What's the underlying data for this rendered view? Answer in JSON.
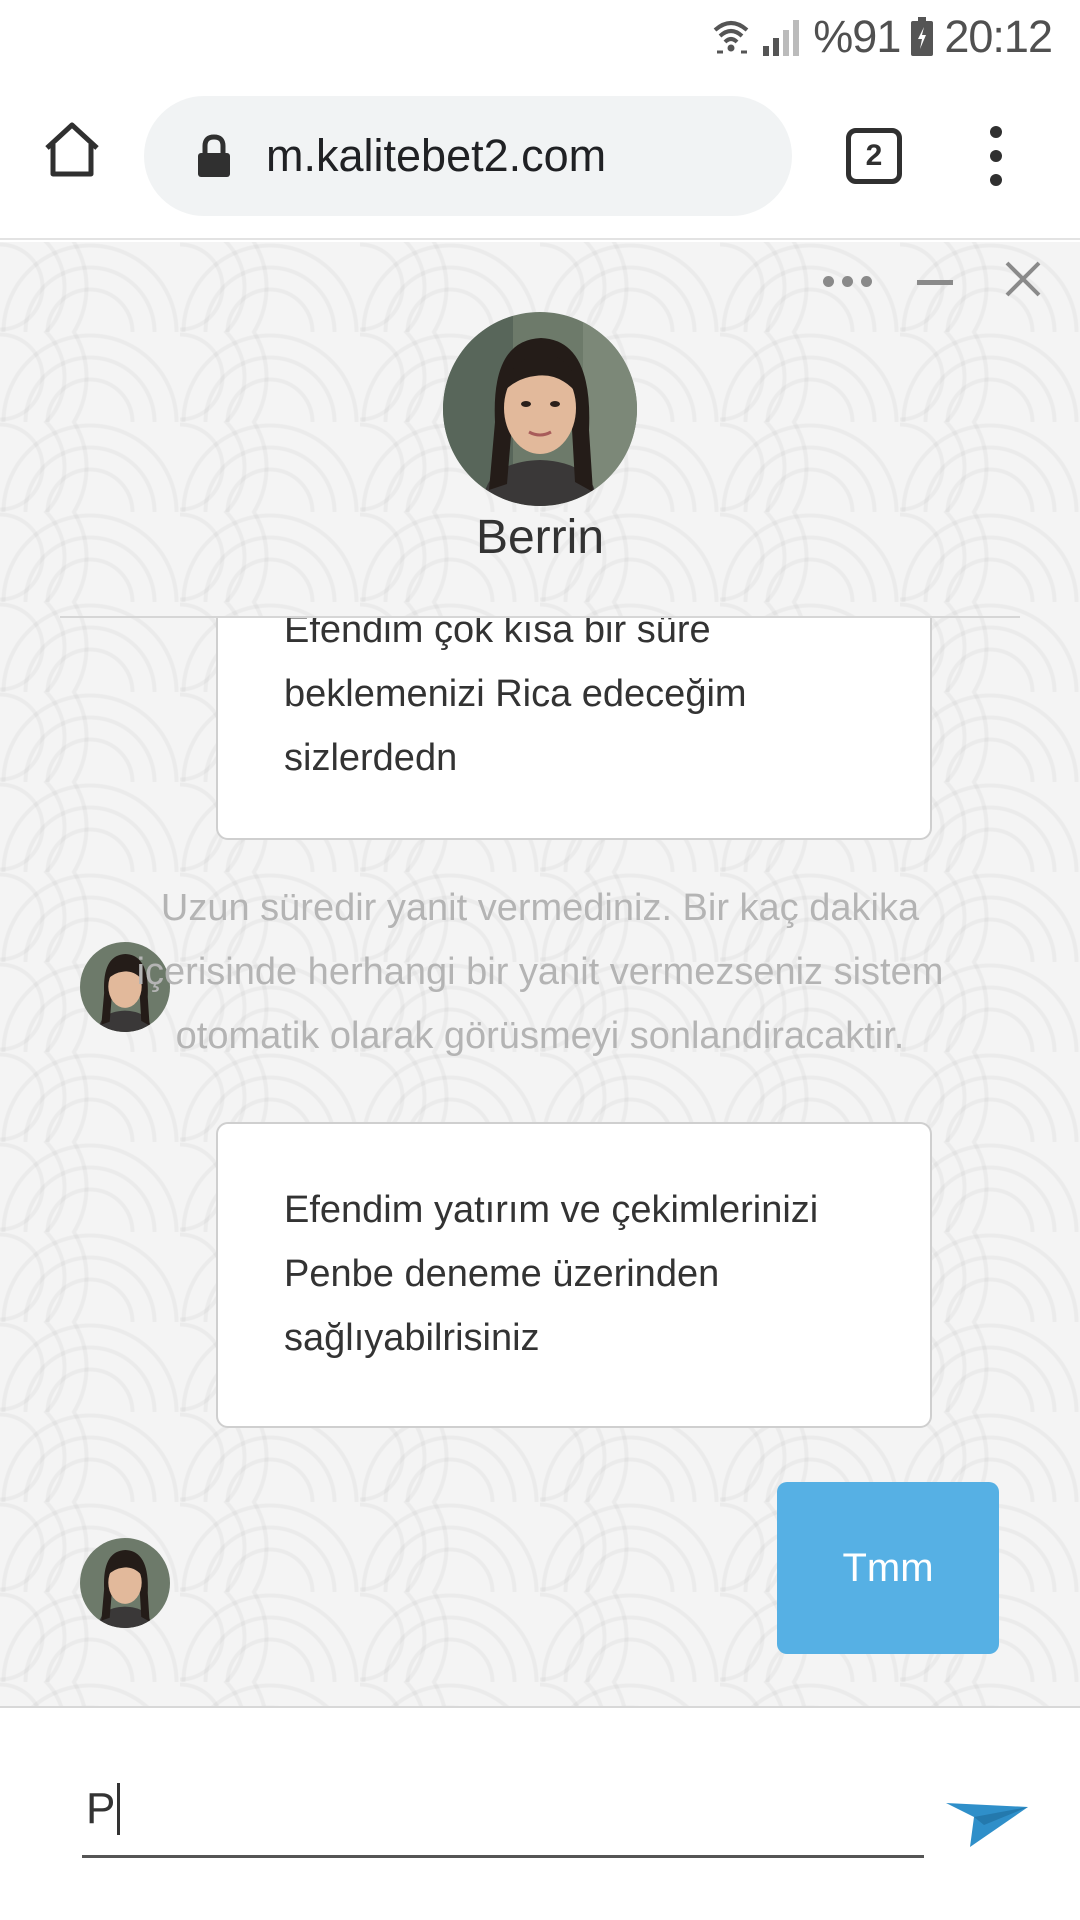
{
  "status_bar": {
    "battery": "%91",
    "time": "20:12",
    "icons": [
      "wifi-icon",
      "signal-icon",
      "battery-icon"
    ]
  },
  "browser": {
    "url": "m.kalitebet2.com",
    "tab_count": "2",
    "icons": [
      "home-icon",
      "lock-icon",
      "tabs-icon",
      "overflow-menu-icon"
    ]
  },
  "chat": {
    "agent_name": "Berrin",
    "controls": [
      "more-icon",
      "minimize-icon",
      "close-icon"
    ],
    "messages": [
      {
        "from": "agent",
        "lines": [
          "Efendim çok kısa bir süre",
          "beklemenizi Rica edeceğim",
          "sizlerdedn"
        ]
      },
      {
        "from": "system",
        "lines": [
          "Uzun süredir yanit vermediniz. Bir kaç dakika",
          "içerisinde herhangi bir yanit vermezseniz sistem",
          "otomatik olarak görüsmeyi sonlandiracaktir."
        ]
      },
      {
        "from": "agent",
        "lines": [
          "Efendim yatırım ve çekimlerinizi",
          "Penbe deneme üzerinden",
          "sağlıyabilrisiniz"
        ]
      },
      {
        "from": "user",
        "text": "Tmm"
      }
    ]
  },
  "composer": {
    "value": "P",
    "send_icon": "send-icon"
  },
  "colors": {
    "user_bubble": "#56b0e4",
    "send_icon": "#2f8fc9",
    "system_text": "#b4b4b4"
  }
}
